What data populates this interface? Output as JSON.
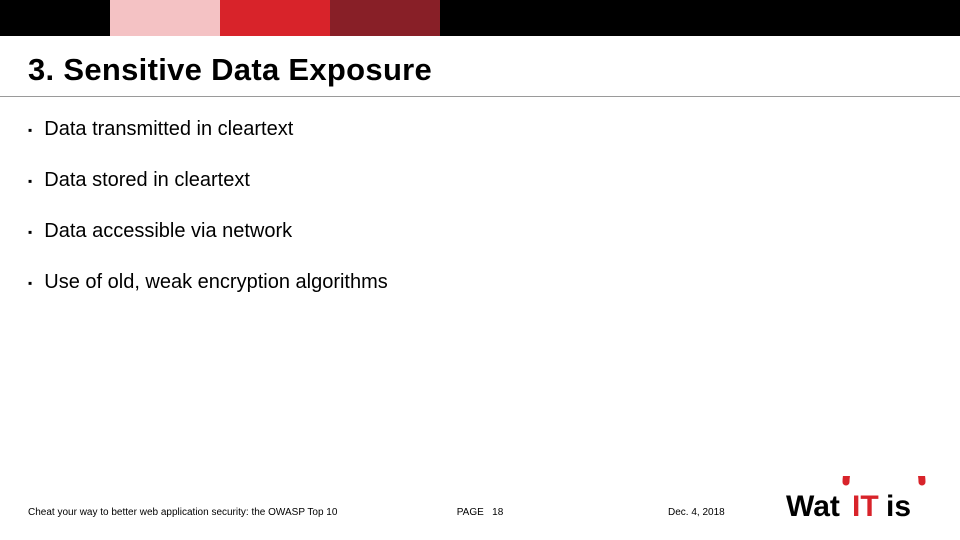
{
  "slide": {
    "title": "3. Sensitive Data Exposure",
    "bullets": [
      "Data transmitted in cleartext",
      "Data stored in cleartext",
      "Data accessible via network",
      "Use of old, weak encryption algorithms"
    ]
  },
  "footer": {
    "title": "Cheat your way to better web application security: the OWASP Top 10",
    "page_label": "PAGE",
    "page_number": "18",
    "date": "Dec. 4, 2018"
  },
  "logo": {
    "text_wat": "Wat",
    "text_it": "IT",
    "text_is": "is"
  },
  "colors": {
    "black": "#000000",
    "pink": "#f4c2c4",
    "red": "#d8232a",
    "darkred": "#881f27"
  }
}
